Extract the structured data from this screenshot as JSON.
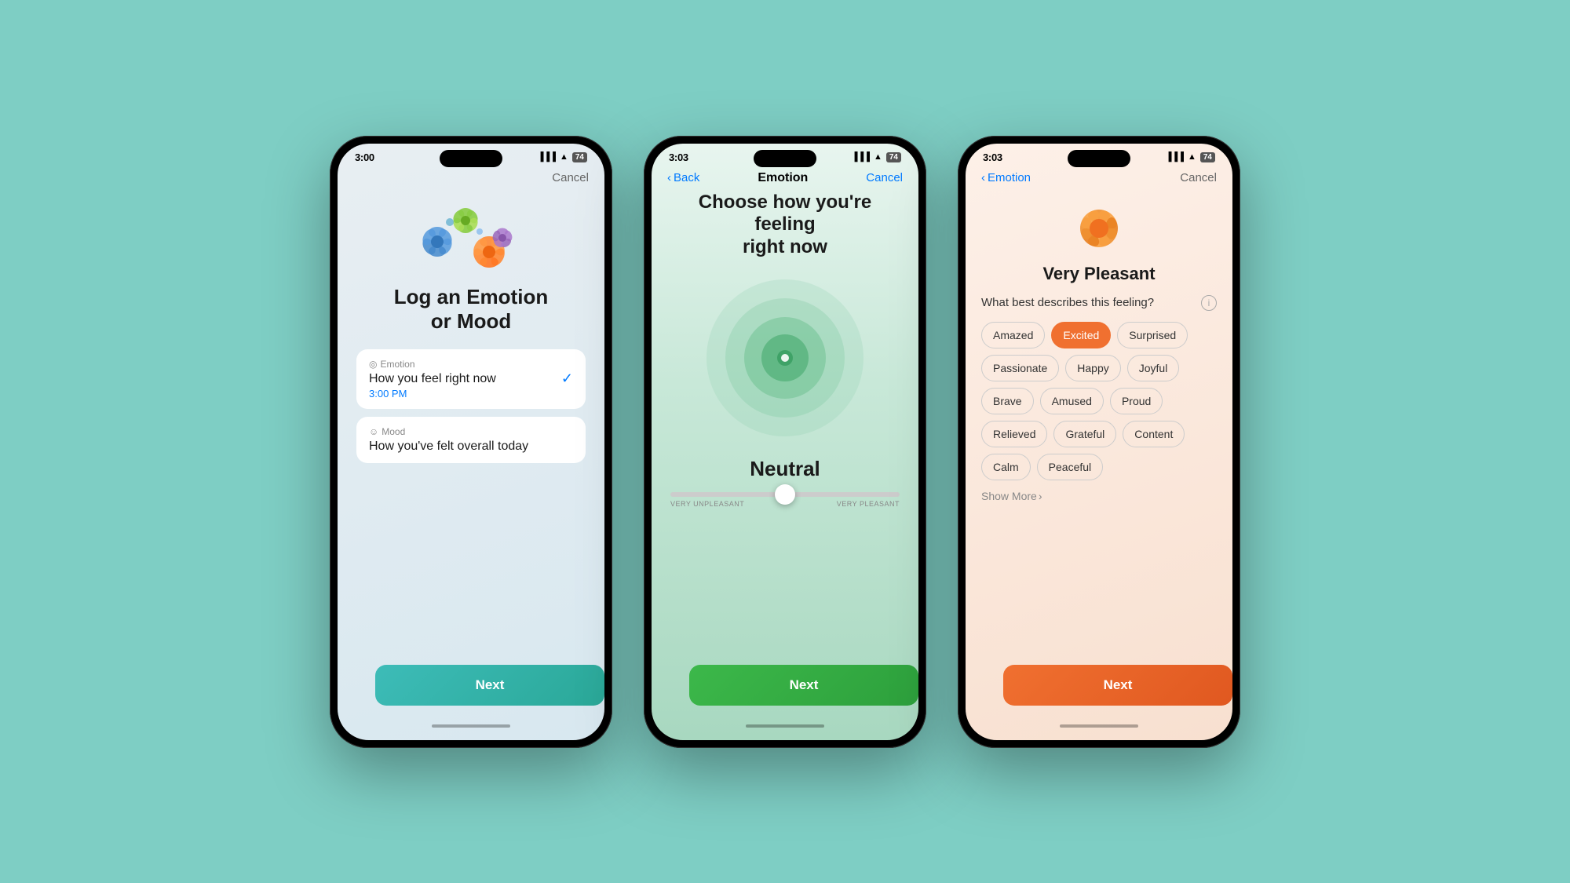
{
  "background_color": "#7ecec4",
  "phone1": {
    "status_time": "3:00",
    "nav_cancel": "Cancel",
    "title_line1": "Log an Emotion",
    "title_line2": "or Mood",
    "emotion_label": "Emotion",
    "emotion_desc": "How you feel right now",
    "emotion_time": "3:00 PM",
    "mood_label": "Mood",
    "mood_desc": "How you've felt overall today",
    "next_btn": "Next"
  },
  "phone2": {
    "status_time": "3:03",
    "nav_back": "Back",
    "nav_title": "Emotion",
    "nav_cancel": "Cancel",
    "choose_title_line1": "Choose how you're feeling",
    "choose_title_line2": "right now",
    "state_label": "Neutral",
    "slider_left": "VERY UNPLEASANT",
    "slider_right": "VERY PLEASANT",
    "next_btn": "Next"
  },
  "phone3": {
    "status_time": "3:03",
    "nav_back": "Emotion",
    "nav_cancel": "Cancel",
    "pleasant_level": "Very Pleasant",
    "question": "What best describes this feeling?",
    "tags": [
      "Amazed",
      "Excited",
      "Surprised",
      "Passionate",
      "Happy",
      "Joyful",
      "Brave",
      "Amused",
      "Proud",
      "Relieved",
      "Grateful",
      "Content",
      "Calm",
      "Peaceful"
    ],
    "show_more": "Show More",
    "next_btn": "Next"
  }
}
